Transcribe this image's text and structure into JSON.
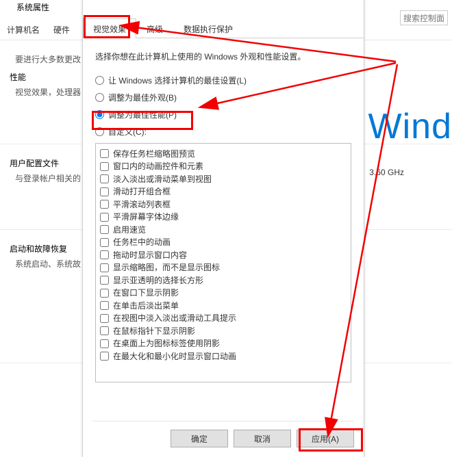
{
  "bg": {
    "title_frag": "系统属性",
    "tabs": {
      "name": "计算机名",
      "hw": "硬件",
      "adv_frag": "高"
    },
    "search_placeholder": "搜索控制面",
    "most_changes": "要进行大多数更改",
    "perf_title": "性能",
    "perf_sub": "视觉效果，处理器",
    "user_title": "用户配置文件",
    "user_sub": "与登录帐户相关的",
    "boot_title": "启动和故障恢复",
    "boot_sub": "系统启动、系统故",
    "brand": "Wind",
    "ghz": "3.60 GHz"
  },
  "dlg": {
    "tabs": {
      "visual": "视觉效果",
      "adv": "高级",
      "dep": "数据执行保护"
    },
    "intro": "选择你想在此计算机上使用的 Windows 外观和性能设置。",
    "radios": {
      "auto": "让 Windows 选择计算机的最佳设置(L)",
      "look": "调整为最佳外观(B)",
      "perf": "调整为最佳性能(P)",
      "custom": "自定义(C):"
    },
    "options": [
      "保存任务栏缩略图预览",
      "窗口内的动画控件和元素",
      "淡入淡出或滑动菜单到视图",
      "滑动打开组合框",
      "平滑滚动列表框",
      "平滑屏幕字体边缘",
      "启用速览",
      "任务栏中的动画",
      "拖动时显示窗口内容",
      "显示缩略图，而不是显示图标",
      "显示亚透明的选择长方形",
      "在窗口下显示阴影",
      "在单击后淡出菜单",
      "在视图中淡入淡出或滑动工具提示",
      "在鼠标指针下显示阴影",
      "在桌面上为图标标签使用阴影",
      "在最大化和最小化时显示窗口动画"
    ],
    "buttons": {
      "ok": "确定",
      "cancel": "取消",
      "apply": "应用(A)"
    }
  }
}
